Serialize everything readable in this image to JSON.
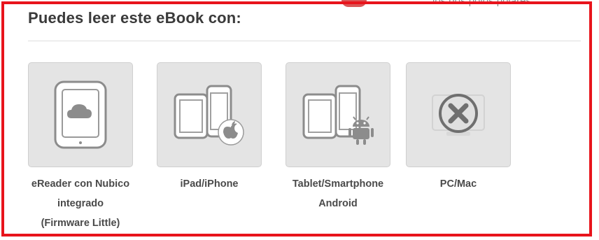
{
  "background": {
    "partial_text": "los dos polos polares"
  },
  "section": {
    "title": "Puedes leer este eBook con:"
  },
  "devices": [
    {
      "label": "eReader con Nubico\nintegrado\n(Firmware Little)",
      "icon": "ereader-cloud-icon"
    },
    {
      "label": "iPad/iPhone",
      "icon": "apple-devices-icon"
    },
    {
      "label": "Tablet/Smartphone\nAndroid",
      "icon": "android-devices-icon"
    },
    {
      "label": "PC/Mac",
      "icon": "unavailable-x-icon"
    }
  ],
  "colors": {
    "frame": "#e8141c",
    "tile": "#e4e4e4",
    "icon": "#8c8c8c"
  }
}
